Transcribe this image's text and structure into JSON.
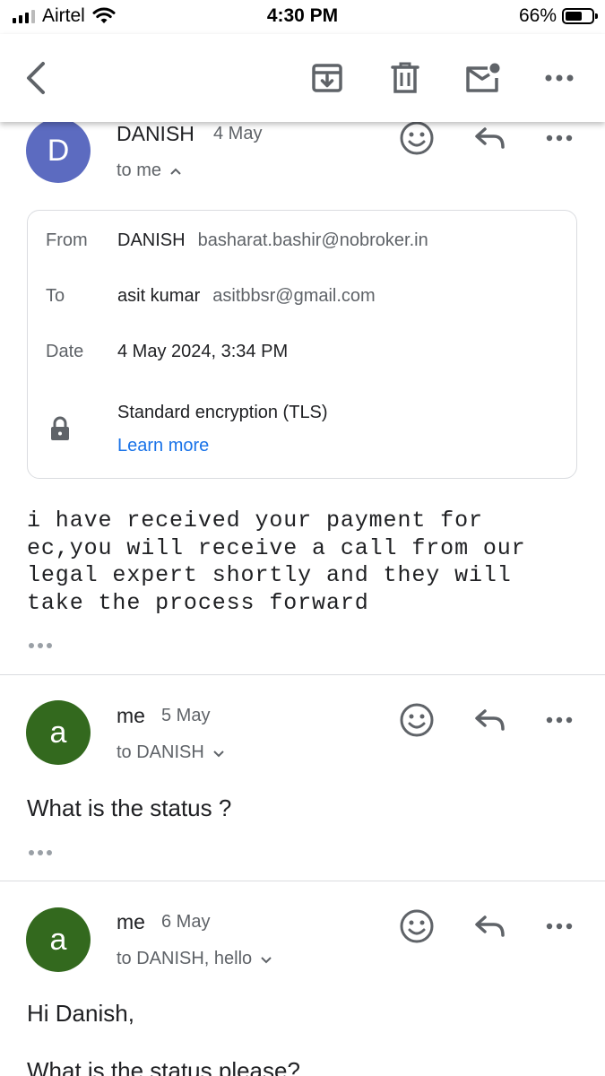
{
  "status_bar": {
    "carrier": "Airtel",
    "time": "4:30 PM",
    "battery_percent": "66%",
    "battery_level": 0.66
  },
  "toolbar": {
    "back_icon": "chevron-left-icon",
    "archive_icon": "archive-icon",
    "delete_icon": "trash-icon",
    "mark_unread_icon": "mail-unread-icon",
    "more_icon": "more-horizontal-icon"
  },
  "messages": [
    {
      "avatar_letter": "D",
      "avatar_color": "#5c6bc0",
      "sender": "DANISH",
      "date": "4 May",
      "recipients": "to me",
      "details": {
        "from_label": "From",
        "from_name": "DANISH",
        "from_email": "basharat.bashir@nobroker.in",
        "to_label": "To",
        "to_name": "asit kumar",
        "to_email": "asitbbsr@gmail.com",
        "date_label": "Date",
        "date_value": "4 May 2024, 3:34 PM",
        "encryption": "Standard encryption (TLS)",
        "learn_more": "Learn more"
      },
      "body_lines": [
        "i have received your payment for",
        "ec,you will receive a call from our",
        "legal expert shortly and they will",
        "take the process forward"
      ]
    },
    {
      "avatar_letter": "a",
      "avatar_color": "#33691e",
      "sender": "me",
      "date": "5 May",
      "recipients": "to DANISH",
      "body": "What is the status ?"
    },
    {
      "avatar_letter": "a",
      "avatar_color": "#33691e",
      "sender": "me",
      "date": "6 May",
      "recipients": "to DANISH, hello",
      "body": "Hi Danish,",
      "body2": "What is the status please?"
    }
  ]
}
